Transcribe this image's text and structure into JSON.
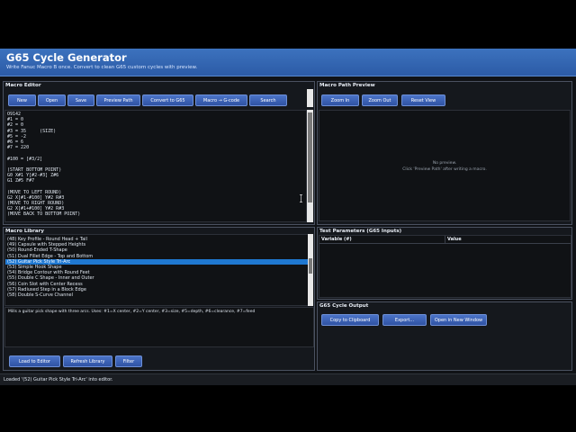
{
  "header": {
    "title": "G65 Cycle Generator",
    "subtitle": "Write Fanuc Macro B once. Convert to clean G65 custom cycles with preview."
  },
  "macro_editor": {
    "title": "Macro Editor",
    "buttons": [
      "New",
      "Open",
      "Save",
      "Preview Path",
      "Convert to G65",
      "Macro → G-code",
      "Search"
    ],
    "code_lines": [
      "O9142",
      "#1 = 0",
      "#2 = 0",
      "#3 = 35     (SIZE)",
      "#5 = -2",
      "#6 = 6",
      "#7 = 220",
      "",
      "#100 = [#3/2]",
      "",
      "(START BOTTOM POINT)",
      "G0 X#1 Y[#2-#3] Z#6",
      "G1 Z#5 F#7",
      "",
      "(MOVE TO LEFT ROUND)",
      "G2 X[#1-#100] Y#2 R#3",
      "(MOVE TO RIGHT ROUND)",
      "G2 X[#1+#100] Y#2 R#3",
      "(MOVE BACK TO BOTTOM POINT)"
    ]
  },
  "macro_path_preview": {
    "title": "Macro Path Preview",
    "buttons": [
      "Zoom In",
      "Zoom Out",
      "Reset View"
    ],
    "empty_title": "No preview.",
    "empty_hint": "Click 'Preview Path' after writing a macro."
  },
  "macro_library": {
    "title": "Macro Library",
    "items": [
      "(48) Key Profile - Round Head + Tail",
      "(49) Capsule with Stepped Heights",
      "(50) Round-Ended T-Shape",
      "(51) Dual Fillet Edge - Top and Bottom",
      "(52) Guitar Pick Style Tri-Arc",
      "(53) Simple Hook Shape",
      "(54) Bridge Contour with Round Feet",
      "(55) Double C Shape - Inner and Outer",
      "(56) Coin Slot with Center Recess",
      "(57) Radiused Step in a Block Edge",
      "(58) Double S-Curve Channel"
    ],
    "selected_index": 4,
    "description": "Mills a guitar pick shape with three arcs. Uses: #1=X center, #2=Y center, #3=size, #5=depth, #6=clearance, #7=feed",
    "buttons": [
      "Load to Editor",
      "Refresh Library",
      "Filter"
    ]
  },
  "test_parameters": {
    "title": "Test Parameters (G65 Inputs)",
    "columns": [
      "Variable (#)",
      "Value"
    ]
  },
  "g65_output": {
    "title": "G65 Cycle Output",
    "buttons": [
      "Copy to Clipboard",
      "Export...",
      "Open in New Window"
    ]
  },
  "status": "Loaded '(52) Guitar Pick Style Tri-Arc' into editor.",
  "colors": {
    "header_bg": "#3465b4",
    "button_bg": "#3d62b8",
    "selection": "#1f78d1",
    "panel_bg": "#15181d"
  }
}
